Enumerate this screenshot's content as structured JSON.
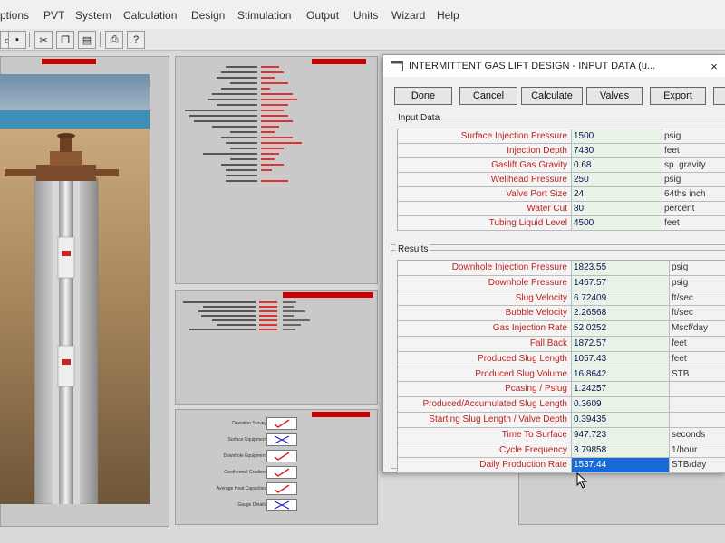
{
  "menu": [
    "ptions",
    "PVT",
    "System",
    "Calculation",
    "Design",
    "Stimulation",
    "Output",
    "Units",
    "Wizard",
    "Help"
  ],
  "toolbar": {
    "icons": [
      "save-icon",
      "cut-icon",
      "copy-icon",
      "paste-icon",
      "print-icon",
      "help-icon"
    ]
  },
  "dialog": {
    "title": "INTERMITTENT GAS LIFT DESIGN - INPUT DATA (u...",
    "buttons": [
      "Done",
      "Cancel",
      "Calculate",
      "Valves",
      "Export"
    ],
    "input_title": "Input Data",
    "inputs": [
      {
        "label": "Surface Injection Pressure",
        "value": "1500",
        "unit": "psig"
      },
      {
        "label": "Injection Depth",
        "value": "7430",
        "unit": "feet"
      },
      {
        "label": "Gaslift Gas Gravity",
        "value": "0.68",
        "unit": "sp. gravity"
      },
      {
        "label": "Wellhead Pressure",
        "value": "250",
        "unit": "psig"
      },
      {
        "label": "Valve Port Size",
        "value": "24",
        "unit": "64ths inch"
      },
      {
        "label": "Water Cut",
        "value": "80",
        "unit": "percent"
      },
      {
        "label": "Tubing Liquid Level",
        "value": "4500",
        "unit": "feet"
      }
    ],
    "results_title": "Results",
    "results": [
      {
        "label": "Downhole Injection Pressure",
        "value": "1823.55",
        "unit": "psig"
      },
      {
        "label": "Downhole Pressure",
        "value": "1467.57",
        "unit": "psig"
      },
      {
        "label": "Slug Velocity",
        "value": "6.72409",
        "unit": "ft/sec"
      },
      {
        "label": "Bubble Velocity",
        "value": "2.26568",
        "unit": "ft/sec"
      },
      {
        "label": "Gas Injection Rate",
        "value": "52.0252",
        "unit": "Mscf/day"
      },
      {
        "label": "Fall Back",
        "value": "1872.57",
        "unit": "feet"
      },
      {
        "label": "Produced Slug Length",
        "value": "1057.43",
        "unit": "feet"
      },
      {
        "label": "Produced Slug Volume",
        "value": "16.8642",
        "unit": "STB"
      },
      {
        "label": "Pcasing / Pslug",
        "value": "1.24257",
        "unit": ""
      },
      {
        "label": "Produced/Accumulated Slug Length",
        "value": "0.3609",
        "unit": ""
      },
      {
        "label": "Starting Slug Length / Valve Depth",
        "value": "0.39435",
        "unit": ""
      },
      {
        "label": "Time To Surface",
        "value": "947.723",
        "unit": "seconds"
      },
      {
        "label": "Cycle Frequency",
        "value": "3.79858",
        "unit": "1/hour"
      },
      {
        "label": "Daily Production Rate",
        "value": "1537.44",
        "unit": "STB/day"
      }
    ]
  },
  "checklist": [
    {
      "label": "Deviation Survey",
      "state": "check"
    },
    {
      "label": "Surface Equipment",
      "state": "cross"
    },
    {
      "label": "Downhole Equipment",
      "state": "check"
    },
    {
      "label": "Geothermal Gradient",
      "state": "check"
    },
    {
      "label": "Average Heat Capacities",
      "state": "check"
    },
    {
      "label": "Gauge Details",
      "state": "cross"
    }
  ]
}
